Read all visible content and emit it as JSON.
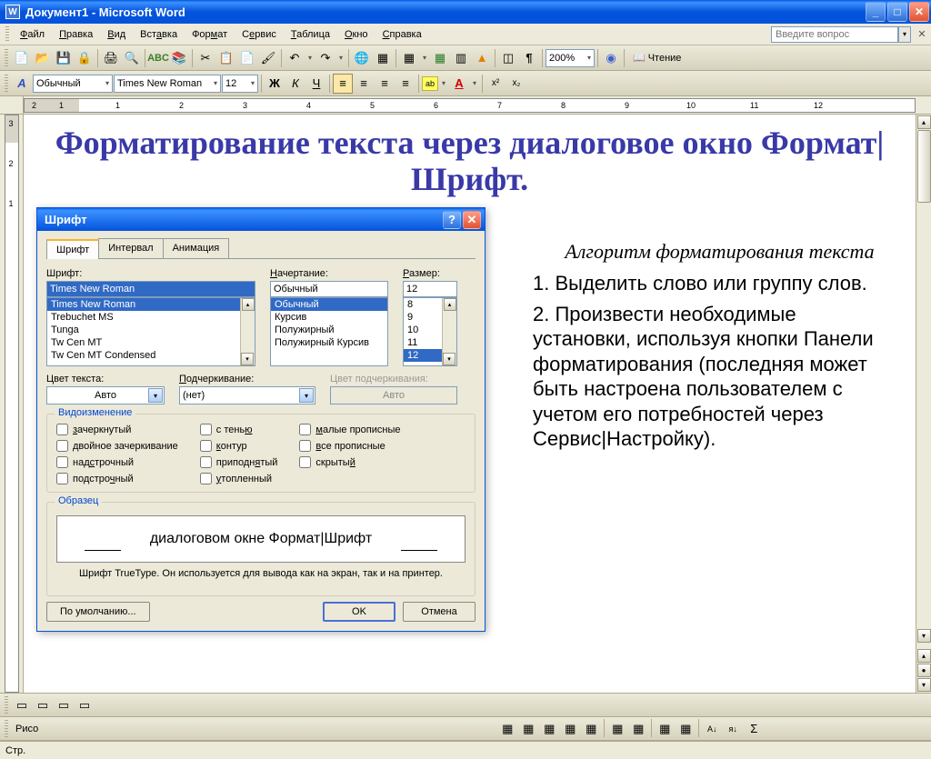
{
  "titlebar": {
    "title": "Документ1 - Microsoft Word"
  },
  "menu": {
    "file": "Файл",
    "edit": "Правка",
    "view": "Вид",
    "insert": "Вставка",
    "format": "Формат",
    "tools": "Сервис",
    "table": "Таблица",
    "window": "Окно",
    "help": "Справка"
  },
  "helpbox": {
    "placeholder": "Введите вопрос"
  },
  "standard_tb": {
    "zoom": "200%",
    "reading": "Чтение"
  },
  "formatting_tb": {
    "style_icon": "A",
    "style": "Обычный",
    "font": "Times New Roman",
    "size": "12"
  },
  "ruler": {
    "nums": [
      "2",
      "1",
      "",
      "1",
      "2",
      "3",
      "4",
      "5",
      "6",
      "7",
      "8",
      "9",
      "10",
      "11",
      "12"
    ]
  },
  "vruler": {
    "nums": [
      "3",
      "2",
      "1"
    ]
  },
  "document": {
    "heading": "Форматирование текста через диалоговое окно Формат|Шрифт.",
    "algo_title": "Алгоритм форматирования текста",
    "step1": "1. Выделить слово или группу слов.",
    "step2": "2. Произвести  необходимые установки,  используя кнопки Панели форматирования (последняя  может быть настроена пользователем с учетом его потребностей через Сервис|Настройку)."
  },
  "dialog": {
    "title": "Шрифт",
    "tabs": {
      "font": "Шрифт",
      "spacing": "Интервал",
      "anim": "Анимация"
    },
    "labels": {
      "font": "Шрифт:",
      "style": "Начертание:",
      "size": "Размер:",
      "color": "Цвет текста:",
      "underline": "Подчеркивание:",
      "ucolor": "Цвет подчеркивания:",
      "effects": "Видоизменение",
      "preview": "Образец"
    },
    "font_input": "Times New Roman",
    "fonts": [
      "Times New Roman",
      "Trebuchet MS",
      "Tunga",
      "Tw Cen MT",
      "Tw Cen MT Condensed"
    ],
    "style_input": "Обычный",
    "styles": [
      "Обычный",
      "Курсив",
      "Полужирный",
      "Полужирный Курсив"
    ],
    "size_input": "12",
    "sizes": [
      "8",
      "9",
      "10",
      "11",
      "12"
    ],
    "color": "Авто",
    "underline": "(нет)",
    "ucolor": "Авто",
    "effects": {
      "strike": "зачеркнутый",
      "dstrike": "двойное зачеркивание",
      "super": "надстрочный",
      "sub": "подстрочный",
      "shadow": "с тенью",
      "outline": "контур",
      "emboss": "приподнятый",
      "engrave": "утопленный",
      "smallcaps": "малые прописные",
      "allcaps": "все прописные",
      "hidden": "скрытый"
    },
    "preview_text": "диалоговом окне Формат|Шрифт",
    "note": "Шрифт TrueType. Он используется для вывода как на экран, так и на принтер.",
    "buttons": {
      "default": "По умолчанию...",
      "ok": "OK",
      "cancel": "Отмена"
    }
  },
  "statusbar": {
    "page": "Стр.",
    "draw": "Рисо"
  }
}
